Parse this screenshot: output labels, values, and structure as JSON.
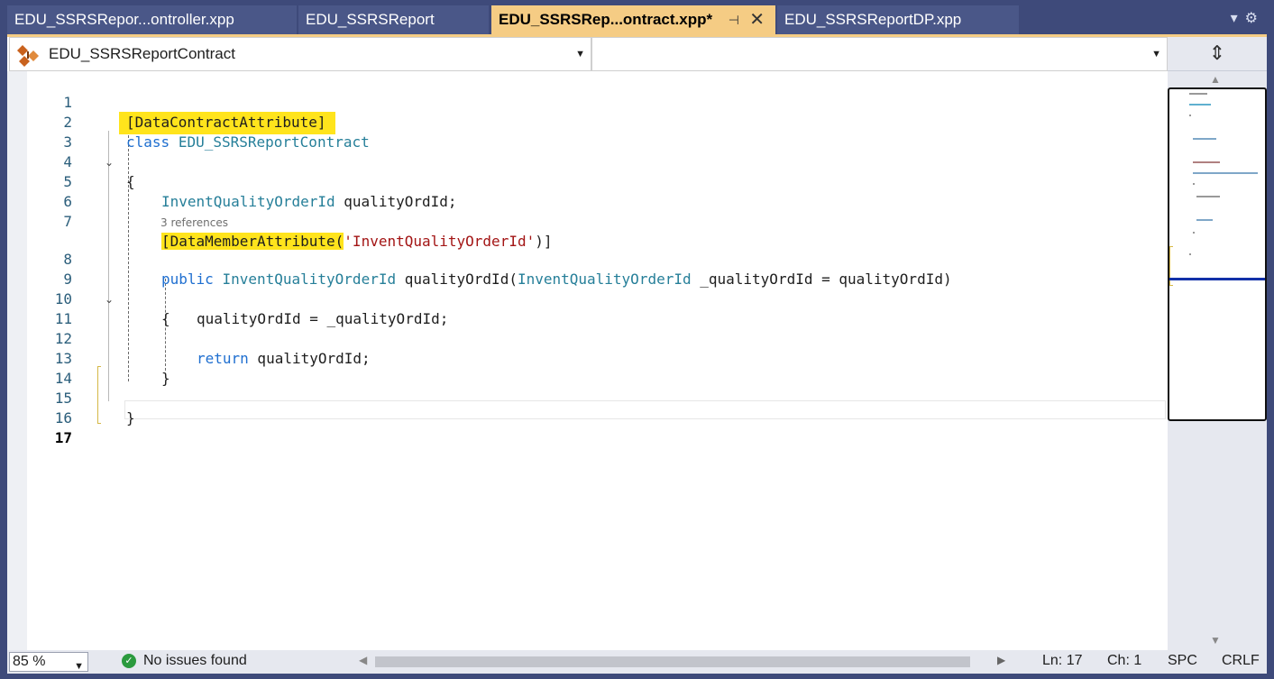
{
  "tabs": [
    {
      "label": "EDU_SSRSRepor...ontroller.xpp",
      "active": false
    },
    {
      "label": "EDU_SSRSReport",
      "active": false
    },
    {
      "label": "EDU_SSRSRep...ontract.xpp*",
      "active": true
    },
    {
      "label": "EDU_SSRSReportDP.xpp",
      "active": false
    }
  ],
  "tab_icons": {
    "pin": "pin-icon",
    "close": "close-icon",
    "dropdown": "chevron-down-icon",
    "settings": "gear-icon"
  },
  "navbar": {
    "class_selector": "EDU_SSRSReportContract",
    "member_selector": ""
  },
  "code": {
    "lines": [
      {
        "n": "1"
      },
      {
        "n": "2"
      },
      {
        "n": "3"
      },
      {
        "n": "4"
      },
      {
        "n": "5"
      },
      {
        "n": "6"
      },
      {
        "n": "7"
      },
      {
        "n": "8"
      },
      {
        "n": "9"
      },
      {
        "n": "10"
      },
      {
        "n": "11"
      },
      {
        "n": "12"
      },
      {
        "n": "13"
      },
      {
        "n": "14"
      },
      {
        "n": "15"
      },
      {
        "n": "16"
      },
      {
        "n": "17"
      }
    ],
    "l1_attr": "[DataContractAttribute]",
    "l2_kw": "class",
    "l2_name": "EDU_SSRSReportContract",
    "l3": "{",
    "l5_type": "InventQualityOrderId",
    "l5_rest": " qualityOrdId;",
    "l7_attr": "[DataMemberAttribute(",
    "l7_str": "'InventQualityOrderId'",
    "l7_end": ")]",
    "codelens": "3 references",
    "l8_kw": "public",
    "l8_type": "InventQualityOrderId",
    "l8_mid": " qualityOrdId(",
    "l8_type2": "InventQualityOrderId",
    "l8_rest": " _qualityOrdId = qualityOrdId)",
    "l9": "{",
    "l10": "qualityOrdId = _qualityOrdId;",
    "l12_kw": "return",
    "l12_rest": " qualityOrdId;",
    "l13": "}",
    "l15": "}"
  },
  "status": {
    "zoom": "85 %",
    "issues": "No issues found",
    "line": "Ln: 17",
    "col": "Ch: 1",
    "whitespace": "SPC",
    "line_ending": "CRLF"
  },
  "colors": {
    "chrome": "#3e4a7a",
    "active_tab": "#f5cc84",
    "keyword": "#1f6fd0",
    "type": "#267f99",
    "string": "#a31515",
    "highlight": "#ffe41c"
  }
}
